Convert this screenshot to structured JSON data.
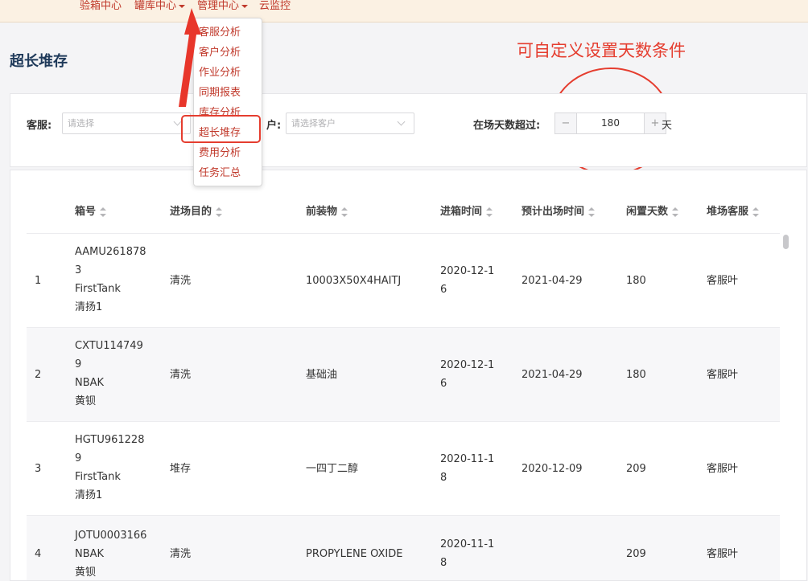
{
  "nav": {
    "items": [
      "验箱中心",
      "罐库中心",
      "管理中心",
      "云监控"
    ]
  },
  "dropdown": {
    "items": [
      "客服分析",
      "客户分析",
      "作业分析",
      "同期报表",
      "库存分析",
      "超长堆存",
      "费用分析",
      "任务汇总"
    ]
  },
  "page": {
    "title": "超长堆存"
  },
  "annotation": {
    "text": "可自定义设置天数条件",
    "color": "#e53d2f"
  },
  "filters": {
    "service_label": "客服:",
    "service_placeholder": "请选择",
    "customer_label": "户:",
    "customer_placeholder": "请选择客户",
    "days_label": "在场天数超过:",
    "days_value": "180",
    "days_unit": "天",
    "minus": "−",
    "plus": "+"
  },
  "table": {
    "headers": [
      "箱号",
      "进场目的",
      "前装物",
      "进箱时间",
      "预计出场时间",
      "闲置天数",
      "堆场客服"
    ],
    "rows": [
      {
        "no": "1",
        "box_lines": [
          "AAMU261878",
          "3",
          "FirstTank",
          "清扬1"
        ],
        "purpose": "清洗",
        "cargo": "10003X50X4HAITJ",
        "in_time_lines": [
          "2020-12-1",
          "6"
        ],
        "out_time": "2021-04-29",
        "idle_days": "180",
        "service": "客服叶"
      },
      {
        "no": "2",
        "box_lines": [
          "CXTU114749",
          "9",
          "NBAK",
          "黄钡"
        ],
        "purpose": "清洗",
        "cargo": "基础油",
        "in_time_lines": [
          "2020-12-1",
          "6"
        ],
        "out_time": "2021-04-29",
        "idle_days": "180",
        "service": "客服叶"
      },
      {
        "no": "3",
        "box_lines": [
          "HGTU961228",
          "9",
          "FirstTank",
          "清扬1"
        ],
        "purpose": "堆存",
        "cargo": "一四丁二醇",
        "in_time_lines": [
          "2020-11-1",
          "8"
        ],
        "out_time": "2020-12-09",
        "idle_days": "209",
        "service": "客服叶"
      },
      {
        "no": "4",
        "box_lines": [
          "JOTU0003166",
          "NBAK",
          "黄钡"
        ],
        "purpose": "清洗",
        "cargo": "PROPYLENE OXIDE",
        "in_time_lines": [
          "2020-11-1",
          "8"
        ],
        "out_time": "",
        "idle_days": "209",
        "service": "客服叶"
      }
    ]
  },
  "icons": {
    "arrow": "red-arrow-icon",
    "sort": "sort-icon",
    "chevron": "chevron-down-icon"
  }
}
